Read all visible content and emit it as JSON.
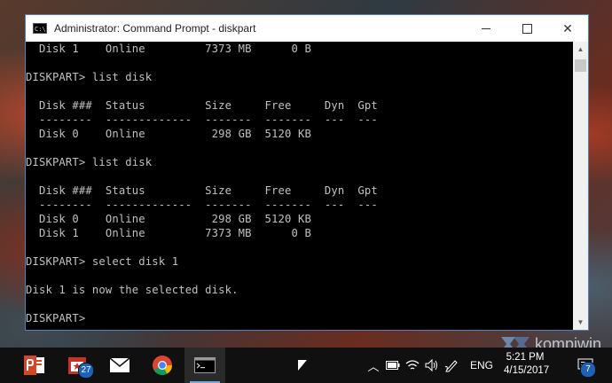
{
  "window": {
    "title": "Administrator: Command Prompt - diskpart",
    "icon_text": "C:\\",
    "controls": {
      "minimize": "minimize-icon",
      "maximize": "maximize-icon",
      "close": "✕"
    }
  },
  "console": {
    "lines": [
      "  Disk 1    Online         7373 MB      0 B",
      "",
      "DISKPART> list disk",
      "",
      "  Disk ###  Status         Size     Free     Dyn  Gpt",
      "  --------  -------------  -------  -------  ---  ---",
      "  Disk 0    Online          298 GB  5120 KB",
      "",
      "DISKPART> list disk",
      "",
      "  Disk ###  Status         Size     Free     Dyn  Gpt",
      "  --------  -------------  -------  -------  ---  ---",
      "  Disk 0    Online          298 GB  5120 KB",
      "  Disk 1    Online         7373 MB      0 B",
      "",
      "DISKPART> select disk 1",
      "",
      "Disk 1 is now the selected disk.",
      "",
      "DISKPART> "
    ]
  },
  "scrollbar": {
    "up": "▲",
    "down": "▼"
  },
  "watermark": {
    "text": "kompiwin"
  },
  "taskbar": {
    "apps": [
      {
        "name": "powerpoint",
        "icon": "powerpoint-icon"
      },
      {
        "name": "calendar",
        "icon": "calendar-icon",
        "badge": "27"
      },
      {
        "name": "mail",
        "icon": "mail-icon"
      },
      {
        "name": "chrome",
        "icon": "chrome-icon"
      },
      {
        "name": "command-prompt",
        "icon": "cmd-icon"
      }
    ],
    "tray": {
      "chevron": "︿",
      "language": "ENG"
    },
    "clock": {
      "time": "5:21 PM",
      "date": "4/15/2017"
    },
    "notifications_badge": "7"
  },
  "colors": {
    "console_bg": "#000000",
    "console_fg": "#c0c0c0",
    "taskbar": "#101010",
    "accent": "#1e62b8"
  }
}
